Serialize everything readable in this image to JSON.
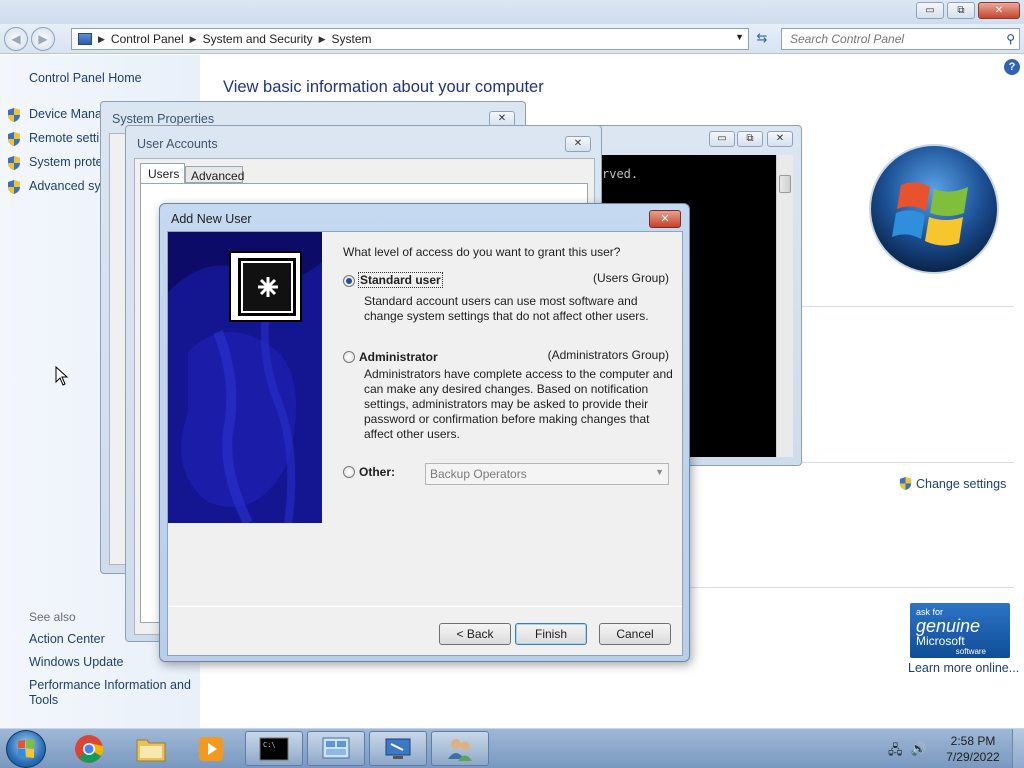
{
  "explorer": {
    "caption_buttons": {
      "minimize": "▭",
      "maximize": "⧉",
      "close": "✕"
    },
    "address": {
      "crumbs": [
        "Control Panel",
        "System and Security",
        "System"
      ]
    },
    "search": {
      "placeholder": "Search Control Panel"
    },
    "left_pane": {
      "home": "Control Panel Home",
      "tasks": [
        "Device Manager",
        "Remote settings",
        "System protection",
        "Advanced system settings"
      ],
      "see_also_header": "See also",
      "see_also": [
        "Action Center",
        "Windows Update",
        "Performance Information and",
        "Tools"
      ]
    },
    "main": {
      "title": "View basic information about your computer",
      "change_settings": "Change settings",
      "genuine": {
        "line1": "ask for",
        "line2": "genuine",
        "line3": "Microsoft",
        "line4": "software"
      },
      "learn_more": "Learn more online..."
    }
  },
  "background_windows": {
    "system_properties": {
      "title": "System Properties"
    },
    "user_accounts": {
      "title": "User Accounts",
      "tabs": [
        "Users",
        "Advanced"
      ]
    },
    "cmd": {
      "visible_text": "rved."
    }
  },
  "dialog": {
    "title": "Add New User",
    "question": "What level of access do you want to grant this user?",
    "options": [
      {
        "label": "Standard user",
        "group": "(Users Group)",
        "selected": true,
        "description": "Standard account users can use most software and change system settings that do not affect other users."
      },
      {
        "label": "Administrator",
        "group": "(Administrators Group)",
        "selected": false,
        "description": "Administrators have complete access to the computer and can make any desired changes. Based on notification settings, administrators may be asked to provide their password or confirmation before making changes that affect other users."
      },
      {
        "label": "Other:",
        "selected": false,
        "select_value": "Backup Operators"
      }
    ],
    "buttons": {
      "back": "< Back",
      "finish": "Finish",
      "cancel": "Cancel"
    }
  },
  "taskbar": {
    "pinned": [
      "start-button",
      "chrome-icon",
      "explorer-icon",
      "media-player-icon",
      "cmd-icon",
      "system-properties-icon",
      "remote-desktop-icon",
      "user-accounts-icon"
    ],
    "clock": {
      "time": "2:58 PM",
      "date": "7/29/2022"
    }
  },
  "colors": {
    "link": "#1e3f73",
    "title": "#1e3287",
    "dialog_art": "#0d0d6e",
    "accent": "#2f64b3"
  }
}
